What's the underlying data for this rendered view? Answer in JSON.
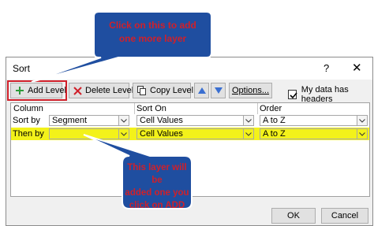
{
  "dialog": {
    "title": "Sort",
    "help_icon": "?",
    "close_icon": "✕",
    "toolbar": {
      "add_level": "Add Level",
      "delete_level": "Delete Level",
      "copy_level": "Copy Level",
      "options": "Options...",
      "headers_label": "My data has headers",
      "headers_checked": true
    },
    "columns": {
      "column": "Column",
      "sort_on": "Sort On",
      "order": "Order"
    },
    "rows": [
      {
        "label": "Sort by",
        "column": "Segment",
        "sort_on": "Cell Values",
        "order": "A to Z"
      },
      {
        "label": "Then by",
        "column": "",
        "sort_on": "Cell Values",
        "order": "A to Z"
      }
    ],
    "ok": "OK",
    "cancel": "Cancel"
  },
  "callouts": {
    "top": [
      "Click on this to add",
      "one more layer"
    ],
    "bottom": [
      "This layer will be",
      "added one you",
      "click on ADD"
    ]
  },
  "colors": {
    "callout_fill": "#1f4ea0",
    "callout_text": "#d0202a",
    "highlight": "#f3f21a",
    "annotation_red": "#d0202a"
  }
}
